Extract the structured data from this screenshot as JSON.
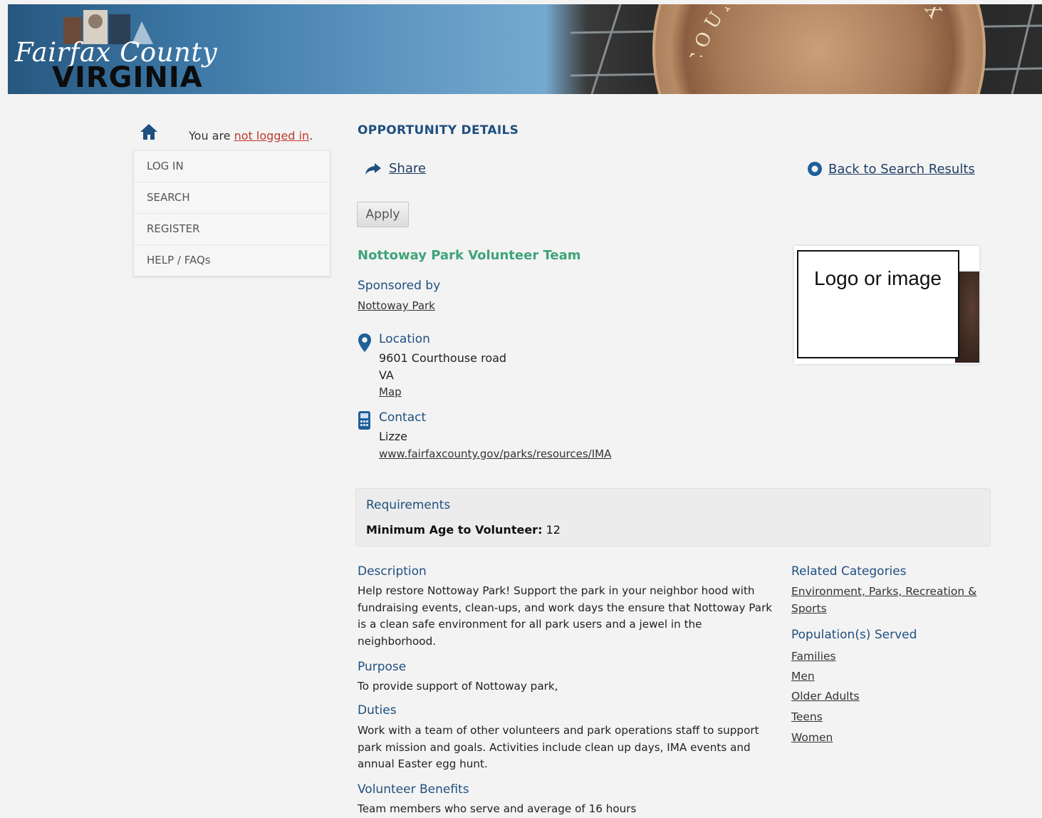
{
  "header": {
    "logo_line1": "Fairfax County",
    "logo_line2": "VIRGINIA",
    "seal_text": "COUNTY OF FAIRFAX"
  },
  "sidebar": {
    "status_prefix": "You are ",
    "status_link": "not logged in",
    "status_suffix": ".",
    "items": [
      {
        "label": "LOG IN"
      },
      {
        "label": "SEARCH"
      },
      {
        "label": "REGISTER"
      },
      {
        "label": "HELP / FAQs"
      }
    ]
  },
  "main": {
    "page_title": "OPPORTUNITY DETAILS",
    "share_label": "Share",
    "back_label": "Back to Search Results",
    "apply_label": "Apply",
    "opportunity_title": "Nottoway Park Volunteer Team",
    "sponsored_label": "Sponsored by",
    "sponsor_name": "Nottoway Park",
    "location": {
      "label": "Location",
      "address": "9601 Courthouse road",
      "state": "VA",
      "map_link": "Map"
    },
    "contact": {
      "label": "Contact",
      "name": "Lizze",
      "url": "www.fairfaxcounty.gov/parks/resources/IMA"
    },
    "logo_placeholder": "Logo or image",
    "requirements": {
      "title": "Requirements",
      "min_age_label": "Minimum Age to Volunteer:",
      "min_age_value": "12"
    },
    "description": {
      "label": "Description",
      "text": "Help restore Nottoway Park! Support the park in your neighbor hood with fundraising events, clean-ups, and work days the ensure that Nottoway Park is a clean safe environment for all park users and a jewel in the neighborhood."
    },
    "purpose": {
      "label": "Purpose",
      "text": "To provide support of Nottoway park,"
    },
    "duties": {
      "label": "Duties",
      "text": "Work with a team of other volunteers and park operations staff to support park mission and goals. Activities include clean up days, IMA events and annual Easter egg hunt."
    },
    "benefits": {
      "label": "Volunteer Benefits",
      "text": "Team members who serve and average of 16 hours"
    },
    "related_categories": {
      "label": "Related Categories",
      "links": [
        "Environment, Parks, Recreation & Sports"
      ]
    },
    "populations": {
      "label": "Population(s) Served",
      "links": [
        "Families",
        "Men",
        "Older Adults",
        "Teens",
        "Women"
      ]
    }
  },
  "icons": {
    "home": "home-icon",
    "share": "share-arrow-icon",
    "back": "back-circle-icon",
    "location": "map-pin-icon",
    "contact": "phone-icon"
  },
  "colors": {
    "accent_blue": "#1f4f80",
    "title_green": "#3fa37a",
    "login_red": "#c0392b"
  }
}
